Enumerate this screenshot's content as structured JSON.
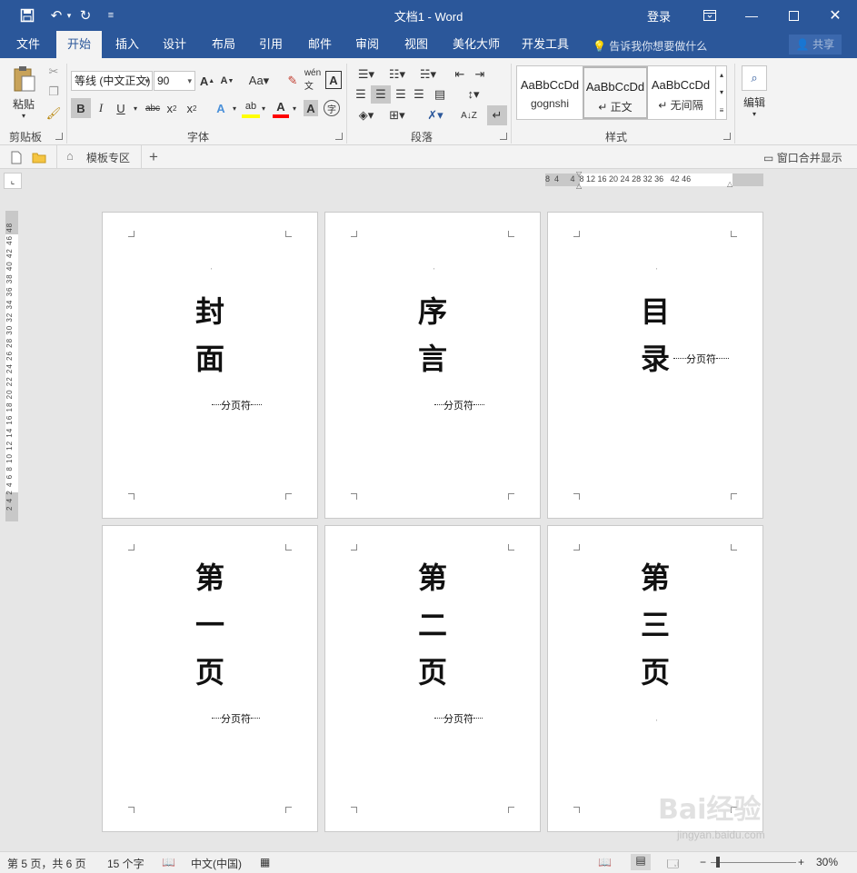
{
  "window": {
    "title": "文档1 - Word",
    "login": "登录",
    "share": "共享",
    "tellme": "告诉我你想要做什么"
  },
  "menu_tabs": [
    "文件",
    "开始",
    "插入",
    "设计",
    "布局",
    "引用",
    "邮件",
    "审阅",
    "视图",
    "美化大师",
    "开发工具"
  ],
  "ribbon": {
    "clipboard": {
      "label": "剪贴板",
      "paste": "粘贴"
    },
    "font": {
      "label": "字体",
      "font_name": "等线 (中文正文)",
      "font_size": "90"
    },
    "paragraph": {
      "label": "段落"
    },
    "styles": {
      "label": "样式",
      "items": [
        {
          "preview": "AaBbCcDd",
          "name": "gognshi"
        },
        {
          "preview": "AaBbCcDd",
          "name": "↵ 正文"
        },
        {
          "preview": "AaBbCcDd",
          "name": "↵ 无间隔"
        }
      ]
    },
    "editing": {
      "label": "编辑"
    }
  },
  "docbar": {
    "template_zone": "模板专区",
    "merge_window": "窗口合并显示"
  },
  "ruler": {
    "h_labels": "8  4     4  8 12 16 20 24 28 32 36   42 46",
    "v_labels": "2 4  2 4 6 8 10 12 14 16 18 20 22 24 26 28 30 32 34 36 38 40 42  46 48"
  },
  "pages": [
    {
      "chars": [
        "封",
        "面"
      ],
      "break_text": "分页符"
    },
    {
      "chars": [
        "序",
        "言"
      ],
      "break_text": "分页符"
    },
    {
      "chars": [
        "目",
        "录"
      ],
      "break_text": "分页符"
    },
    {
      "chars": [
        "第",
        "一",
        "页"
      ],
      "break_text": "分页符"
    },
    {
      "chars": [
        "第",
        "二",
        "页"
      ],
      "break_text": "分页符"
    },
    {
      "chars": [
        "第",
        "三",
        "页"
      ],
      "break_text": ""
    }
  ],
  "status": {
    "page": "第 5 页，共 6 页",
    "words": "15 个字",
    "language": "中文(中国)",
    "zoom": "30%"
  },
  "watermark": {
    "brand": "Bai经验",
    "url": "jingyan.baidu.com"
  },
  "colors": {
    "accent": "#2b579a",
    "ribbon_bg": "#f3f3f3",
    "highlight": "#ffff00",
    "font_color": "#ff0000"
  }
}
